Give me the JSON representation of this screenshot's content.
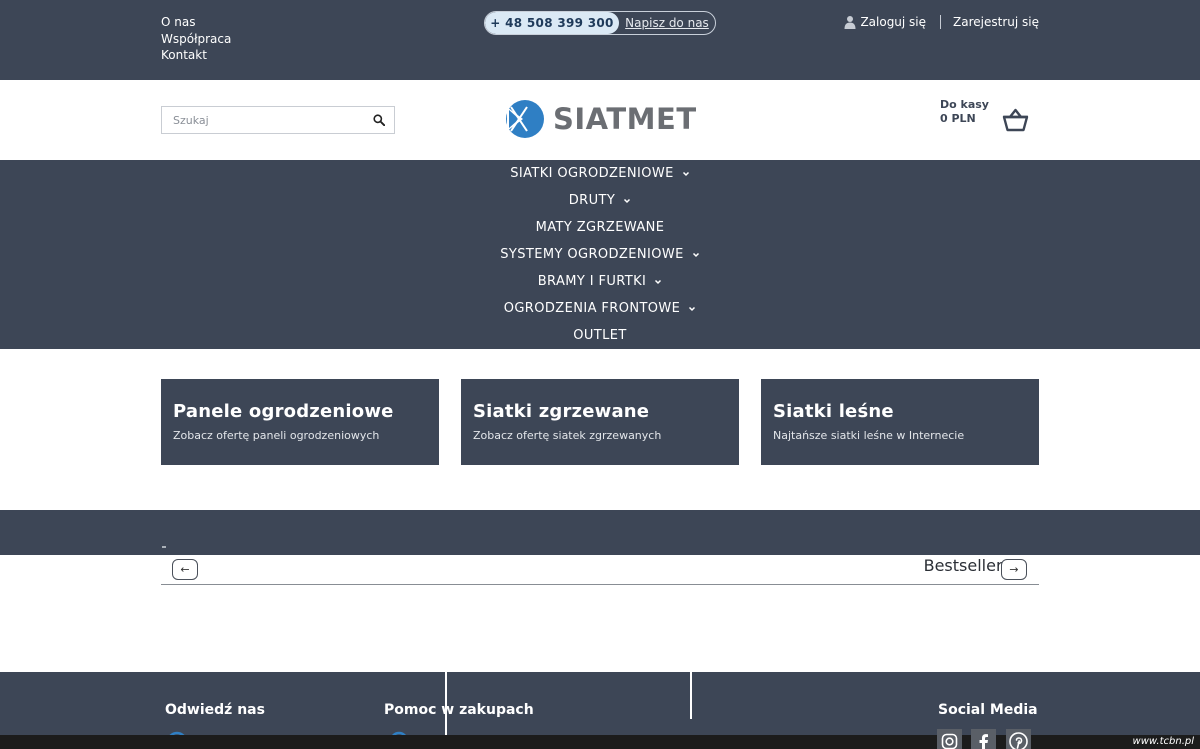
{
  "topbar": {
    "links": [
      "O nas",
      "Współpraca",
      "Kontakt"
    ],
    "phone": "+ 48 508 399 300",
    "write_to_us": "Napisz do nas",
    "login": "Zaloguj się",
    "register": "Zarejestruj się"
  },
  "header": {
    "search_placeholder": "Szukaj",
    "logo_text": "SIATMET",
    "cart_label": "Do kasy",
    "cart_total": "0 PLN"
  },
  "nav": {
    "items": [
      {
        "label": "SIATKI OGRODZENIOWE",
        "has_dropdown": true
      },
      {
        "label": "DRUTY",
        "has_dropdown": true
      },
      {
        "label": "MATY ZGRZEWANE",
        "has_dropdown": false
      },
      {
        "label": "SYSTEMY OGRODZENIOWE",
        "has_dropdown": true
      },
      {
        "label": "BRAMY I FURTKI",
        "has_dropdown": true
      },
      {
        "label": "OGRODZENIA FRONTOWE",
        "has_dropdown": true
      },
      {
        "label": "OUTLET",
        "has_dropdown": false
      }
    ]
  },
  "tiles": [
    {
      "title": "Panele ogrodzeniowe",
      "subtitle": "Zobacz ofertę paneli ogrodzeniowych"
    },
    {
      "title": "Siatki zgrzewane",
      "subtitle": "Zobacz ofertę siatek zgrzewanych"
    },
    {
      "title": "Siatki leśne",
      "subtitle": "Najtańsze siatki leśne w Internecie"
    }
  ],
  "bestsellers": {
    "title": "Bestsellery",
    "prev": "←",
    "next": "→"
  },
  "footer": {
    "visit_us": "Odwiedź nas",
    "shopping_help": "Pomoc w zakupach",
    "social_media": "Social Media"
  },
  "watermark": "www.tcbn.pl",
  "colors": {
    "primary_dark": "#3d4656",
    "logo_blue": "#2f7fc4",
    "logo_gray": "#6b6e73",
    "phone_pill_bg": "#dbe9f5"
  }
}
